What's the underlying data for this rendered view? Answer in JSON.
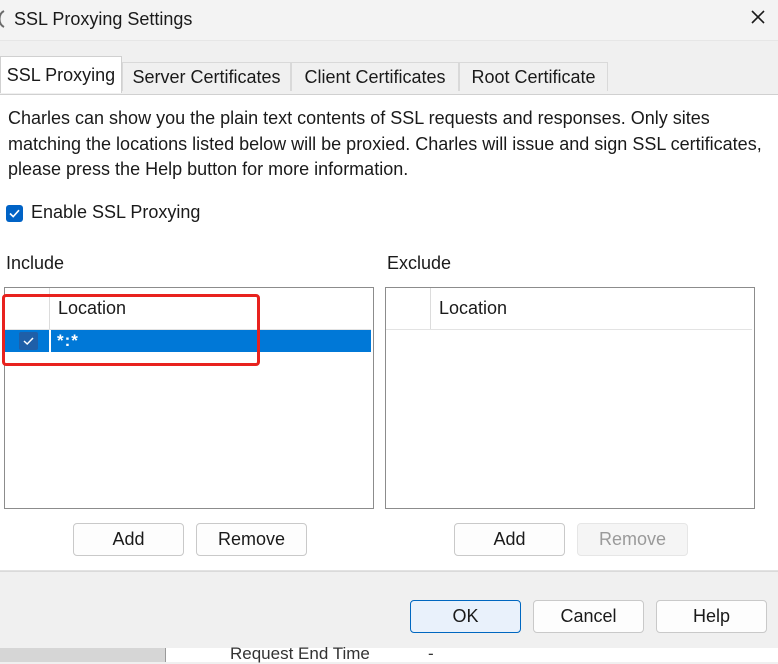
{
  "window": {
    "title": "SSL Proxying Settings",
    "close_icon": "close-icon"
  },
  "tabs": [
    {
      "label": "SSL Proxying",
      "active": true
    },
    {
      "label": "Server Certificates",
      "active": false
    },
    {
      "label": "Client Certificates",
      "active": false
    },
    {
      "label": "Root Certificate",
      "active": false
    }
  ],
  "panel": {
    "description": "Charles can show you the plain text contents of SSL requests and responses. Only sites matching the locations listed below will be proxied. Charles will issue and sign SSL certificates, please press the Help button for more information.",
    "enable_checkbox": {
      "label": "Enable SSL Proxying",
      "checked": true
    },
    "include": {
      "label": "Include",
      "column_header": "Location",
      "rows": [
        {
          "checked": true,
          "location": "*:*",
          "selected": true
        }
      ],
      "add_label": "Add",
      "remove_label": "Remove"
    },
    "exclude": {
      "label": "Exclude",
      "column_header": "Location",
      "rows": [],
      "add_label": "Add",
      "remove_label": "Remove",
      "remove_disabled": true
    }
  },
  "footer": {
    "ok_label": "OK",
    "cancel_label": "Cancel",
    "help_label": "Help"
  },
  "background": {
    "row_text": "Request End Time",
    "row_value": "-"
  },
  "colors": {
    "accent": "#0078d7",
    "checkbox": "#0063c6",
    "highlight": "#e8221e"
  }
}
